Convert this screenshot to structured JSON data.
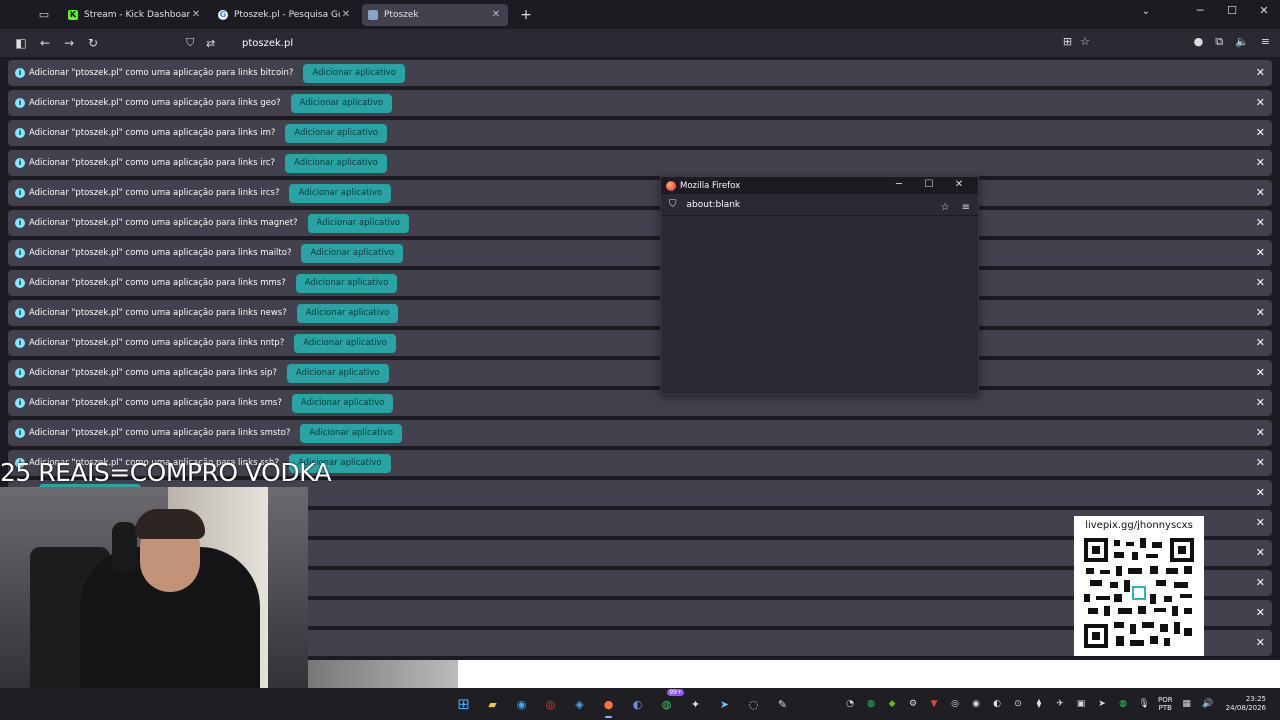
{
  "tabstrip": {
    "tabs": [
      {
        "title": "Stream - Kick Dashboard",
        "favicon": "kick-icon",
        "active": false,
        "accent": "#53fc18"
      },
      {
        "title": "Ptoszek.pl - Pesquisa Google",
        "favicon": "google-icon",
        "active": false,
        "accent": "#4285f4"
      },
      {
        "title": "Ptoszek",
        "favicon": "page-icon",
        "active": true,
        "accent": "#8aa4c8"
      }
    ]
  },
  "navbar": {
    "url": "ptoszek.pl"
  },
  "notifications": {
    "message_prefix": "Adicionar \"ptoszek.pl\" como uma aplicação para links ",
    "button_label": "Adicionar aplicativo",
    "items": [
      {
        "text": "Adicionar \"ptoszek.pl\" como uma aplicação para links bitcoin?"
      },
      {
        "text": "Adicionar \"ptoszek.pl\" como uma aplicação para links geo?"
      },
      {
        "text": "Adicionar \"ptoszek.pl\" como uma aplicação para links im?"
      },
      {
        "text": "Adicionar \"ptoszek.pl\" como uma aplicação para links irc?"
      },
      {
        "text": "Adicionar \"ptoszek.pl\" como uma aplicação para links ircs?"
      },
      {
        "text": "Adicionar \"ptoszek.pl\" como uma aplicação para links magnet?"
      },
      {
        "text": "Adicionar \"ptoszek.pl\" como uma aplicação para links mailto?"
      },
      {
        "text": "Adicionar \"ptoszek.pl\" como uma aplicação para links mms?"
      },
      {
        "text": "Adicionar \"ptoszek.pl\" como uma aplicação para links news?"
      },
      {
        "text": "Adicionar \"ptoszek.pl\" como uma aplicação para links nntp?"
      },
      {
        "text": "Adicionar \"ptoszek.pl\" como uma aplicação para links sip?"
      },
      {
        "text": "Adicionar \"ptoszek.pl\" como uma aplicação para links sms?"
      },
      {
        "text": "Adicionar \"ptoszek.pl\" como uma aplicação para links smsto?"
      },
      {
        "text": "Adicionar \"ptoszek.pl\" como uma aplicação para links ssh?"
      },
      {
        "text": ""
      },
      {
        "text": ""
      },
      {
        "text": ""
      },
      {
        "text": ""
      },
      {
        "text": ""
      },
      {
        "text": ""
      }
    ]
  },
  "popup": {
    "title": "Mozilla Firefox",
    "url": "about:blank"
  },
  "overlay": {
    "donation_text": "25 REAIS=COMPRO VODKA",
    "qr_label": "livepix.gg/jhonnyscxs"
  },
  "taskbar": {
    "badge": "99+",
    "lang_top": "POR",
    "lang_bottom": "PTB",
    "time": "23:25",
    "date": "24/08/2026"
  }
}
